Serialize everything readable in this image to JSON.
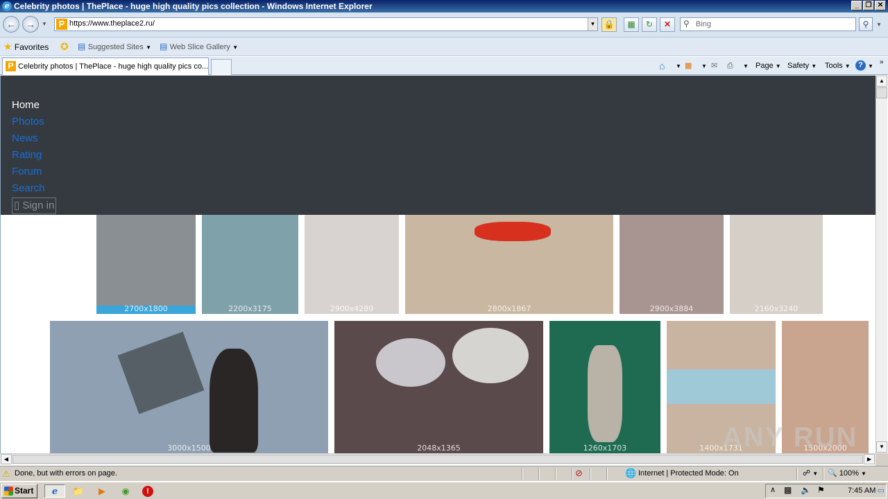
{
  "window": {
    "title": "Celebrity photos | ThePlace - huge high quality pics collection - Windows Internet Explorer",
    "controls": [
      "_",
      "❐",
      "✕"
    ]
  },
  "navbar": {
    "url": "https://www.theplace2.ru/",
    "search_placeholder": "Bing"
  },
  "favorites_bar": {
    "favorites_label": "Favorites",
    "suggested_sites": "Suggested Sites",
    "web_slice_gallery": "Web Slice Gallery"
  },
  "tabs": {
    "active_title": "Celebrity photos | ThePlace - huge high quality pics co...",
    "commands": {
      "page": "Page",
      "safety": "Safety",
      "tools": "Tools"
    }
  },
  "site_nav": {
    "home": "Home",
    "photos": "Photos",
    "news": "News",
    "rating": "Rating",
    "forum": "Forum",
    "search": "Search",
    "sign_in": "▯ Sign in"
  },
  "photos_row1": [
    {
      "label": "2700x1800",
      "color": "#8a8f94"
    },
    {
      "label": "2200x3175",
      "color": "#7fa1aa"
    },
    {
      "label": "2900x4289",
      "color": "#d8d3d0"
    },
    {
      "label": "2800x1867",
      "color": "#c9b7a1"
    },
    {
      "label": "2900x3884",
      "color": "#a89592"
    },
    {
      "label": "2160x3240",
      "color": "#d6cfc8"
    }
  ],
  "photos_row2": [
    {
      "label": "3000x1500",
      "color": "#8ea0b1"
    },
    {
      "label": "2048x1365",
      "color": "#5a4a4c"
    },
    {
      "label": "1260x1703",
      "color": "#1f6b52"
    },
    {
      "label": "1400x1731",
      "color": "#c8b4a0"
    },
    {
      "label": "1500x2000",
      "color": "#c9a48f"
    }
  ],
  "statusbar": {
    "message": "Done, but with errors on page.",
    "zone": "Internet | Protected Mode: On",
    "zoom": "100%"
  },
  "taskbar": {
    "start": "Start",
    "clock": "7:45 AM"
  },
  "watermark": "ANY RUN"
}
